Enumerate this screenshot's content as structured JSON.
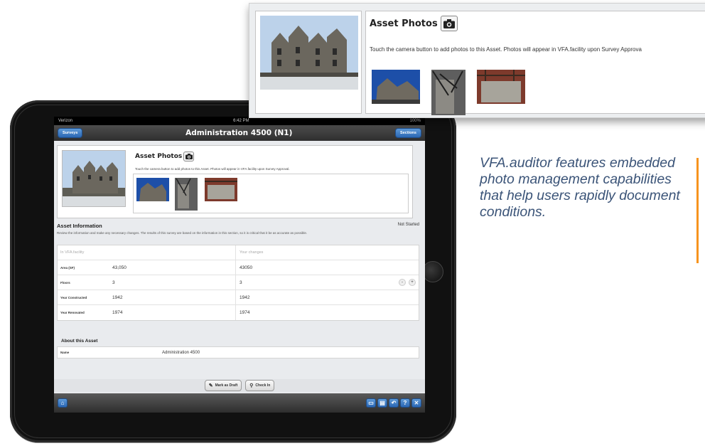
{
  "colors": {
    "accent": "#f7941e",
    "caption": "#3b5478",
    "nav_button": "#2b67b3"
  },
  "callout": {
    "title": "Asset Photos",
    "description": "Touch the camera button to add photos to this Asset. Photos will appear in VFA.facility upon Survey Approva",
    "camera_icon": "camera-icon"
  },
  "caption": {
    "text": "VFA.auditor features embedded photo management capabilities that help users rapidly document conditions."
  },
  "ipad": {
    "status": {
      "carrier": "Verizon",
      "time": "6:42 PM",
      "battery": "100%"
    },
    "nav": {
      "left_button": "Surveys",
      "title": "Administration 4500 (N1)",
      "right_button": "Sections"
    },
    "photos": {
      "title": "Asset Photos",
      "description": "Touch the camera button to add photos to this Asset. Photos will appear in VFA.facility upon Survey Approval."
    },
    "asset_info": {
      "heading": "Asset Information",
      "status": "Not Started",
      "description": "Review the information and make any necessary changes. The results of this survey are based on the information in this section, so it is critical that it be as accurate as possible.",
      "col_current": "In VFA.facility",
      "col_changes": "Your changes",
      "rows": [
        {
          "label": "Area (SF)",
          "current": "43,050",
          "new": "43050"
        },
        {
          "label": "Floors",
          "current": "3",
          "new": "3"
        },
        {
          "label": "Year Constructed",
          "current": "1942",
          "new": "1942"
        },
        {
          "label": "Year Renovated",
          "current": "1974",
          "new": "1974"
        }
      ],
      "stepper_minus": "-",
      "stepper_plus": "+"
    },
    "about": {
      "heading": "About this Asset",
      "name_label": "Name",
      "name_value": "Administration 4500"
    },
    "actions": {
      "draft": "Mark as Draft",
      "checkin": "Check In"
    },
    "toolbar": {
      "help": "?"
    }
  }
}
